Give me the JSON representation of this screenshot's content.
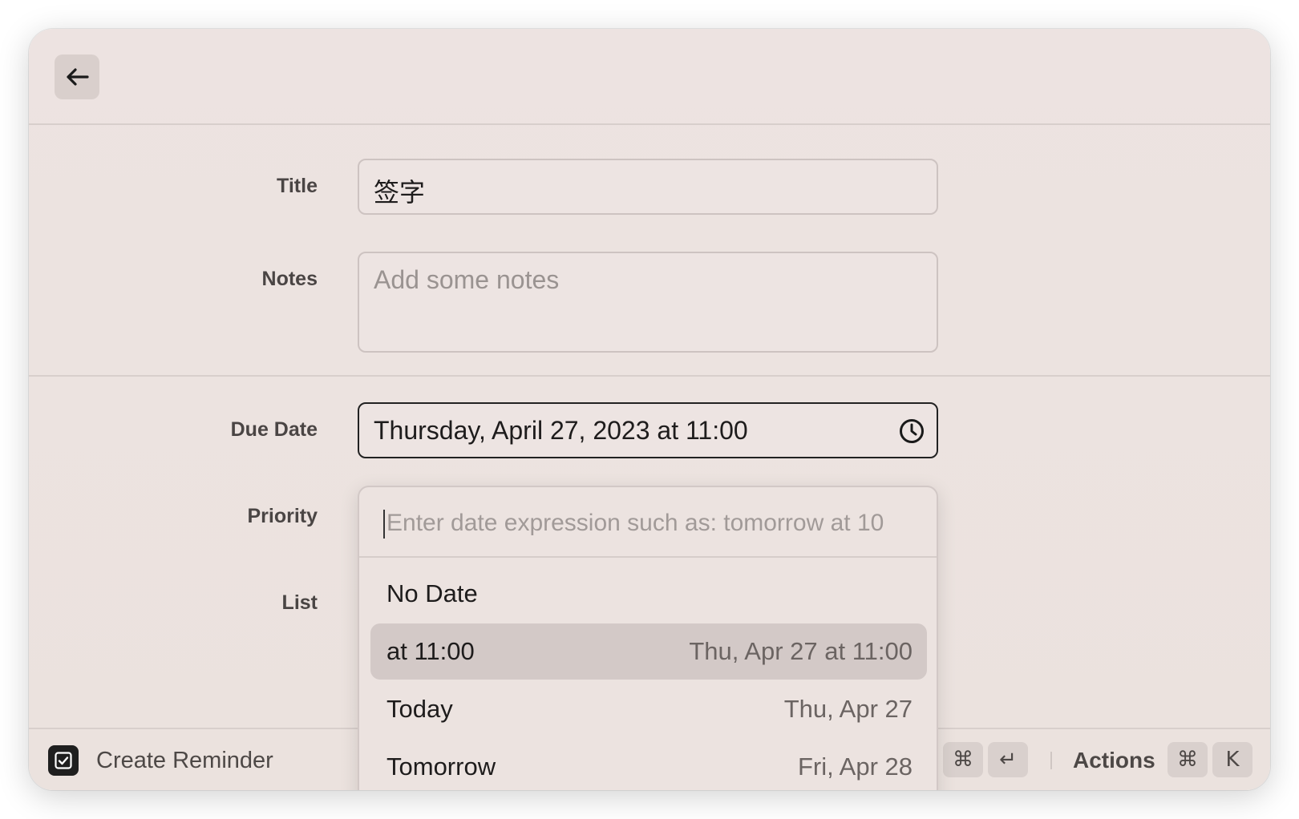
{
  "form": {
    "title_label": "Title",
    "title_value": "签字",
    "notes_label": "Notes",
    "notes_placeholder": "Add some notes",
    "due_date_label": "Due Date",
    "due_date_value": "Thursday, April 27, 2023 at 11:00",
    "priority_label": "Priority",
    "list_label": "List"
  },
  "dropdown": {
    "search_placeholder": "Enter date expression such as: tomorrow at 10",
    "items": [
      {
        "label": "No Date",
        "value": ""
      },
      {
        "label": "at 11:00",
        "value": "Thu, Apr 27 at 11:00",
        "selected": true
      },
      {
        "label": "Today",
        "value": "Thu, Apr 27"
      },
      {
        "label": "Tomorrow",
        "value": "Fri, Apr 28"
      }
    ]
  },
  "bottombar": {
    "primary_action": "Create Reminder",
    "submit_keys": [
      "⌘",
      "↵"
    ],
    "actions_label": "Actions",
    "actions_keys": [
      "⌘",
      "K"
    ]
  },
  "icons": {
    "back": "arrow-left-icon",
    "clock": "clock-icon",
    "reminder": "checkbox-icon"
  }
}
